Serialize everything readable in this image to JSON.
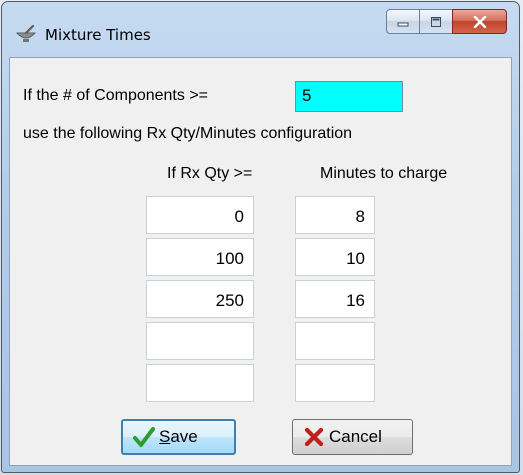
{
  "window": {
    "title": "Mixture Times"
  },
  "form": {
    "components_prompt": "If the # of Components >=",
    "components_value": "5",
    "instruction": "use the following Rx Qty/Minutes configuration",
    "col_qty_header": "If Rx Qty >=",
    "col_minutes_header": "Minutes to charge",
    "rows": [
      {
        "qty": "0",
        "minutes": "8"
      },
      {
        "qty": "100",
        "minutes": "10"
      },
      {
        "qty": "250",
        "minutes": "16"
      },
      {
        "qty": "",
        "minutes": ""
      },
      {
        "qty": "",
        "minutes": ""
      }
    ]
  },
  "buttons": {
    "save_label": "Save",
    "save_mnemonic": "S",
    "save_rest": "ave",
    "cancel_label": "Cancel"
  },
  "icons": {
    "app": "mortar-pestle-icon",
    "minimize": "minimize-icon",
    "maximize": "maximize-icon",
    "close": "close-icon",
    "save": "checkmark-icon",
    "cancel": "x-mark-icon"
  },
  "colors": {
    "highlight_field": "#00ffff",
    "save_check": "#2e9b2e",
    "cancel_x": "#c0201a"
  }
}
